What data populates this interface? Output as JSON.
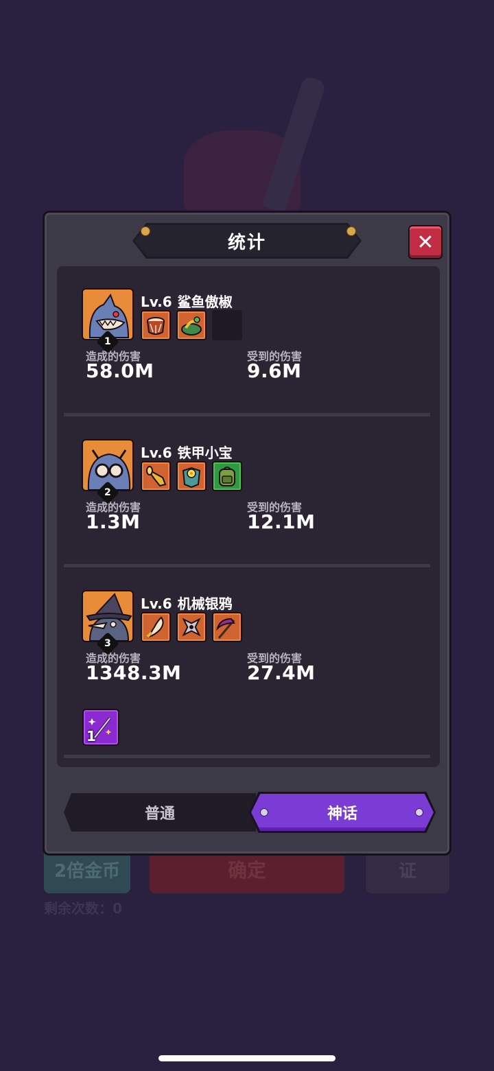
{
  "background": {
    "double_gold": "2倍金币",
    "confirm": "确定",
    "third": "证",
    "remaining": "剩余次数：0"
  },
  "modal": {
    "title": "统计",
    "close_icon": "close-icon",
    "heroes": [
      {
        "level": "Lv.6",
        "name": "鲨鱼傲椒",
        "rank": "1",
        "damage_dealt_label": "造成的伤害",
        "damage_dealt": "58.0M",
        "damage_taken_label": "受到的伤害",
        "damage_taken": "9.6M",
        "items": [
          "drum-icon",
          "pepper-plate-icon",
          "empty-slot"
        ]
      },
      {
        "level": "Lv.6",
        "name": "铁甲小宝",
        "rank": "2",
        "damage_dealt_label": "造成的伤害",
        "damage_dealt": "1.3M",
        "damage_taken_label": "受到的伤害",
        "damage_taken": "12.1M",
        "items": [
          "horn-icon",
          "flower-armor-icon",
          "backpack-icon"
        ]
      },
      {
        "level": "Lv.6",
        "name": "机械银鸦",
        "rank": "3",
        "damage_dealt_label": "造成的伤害",
        "damage_dealt": "1348.3M",
        "damage_taken_label": "受到的伤害",
        "damage_taken": "27.4M",
        "items": [
          "fang-icon",
          "shuriken-icon",
          "scythe-icon"
        ]
      }
    ],
    "bonus_item": {
      "icon": "magic-wand-icon",
      "count": "1"
    },
    "tabs": {
      "normal": "普通",
      "myth": "神话",
      "active": "myth"
    }
  },
  "colors": {
    "accent_purple": "#7b3cd6",
    "close_red": "#c02d45",
    "portrait_orange": "#e88c3a"
  }
}
